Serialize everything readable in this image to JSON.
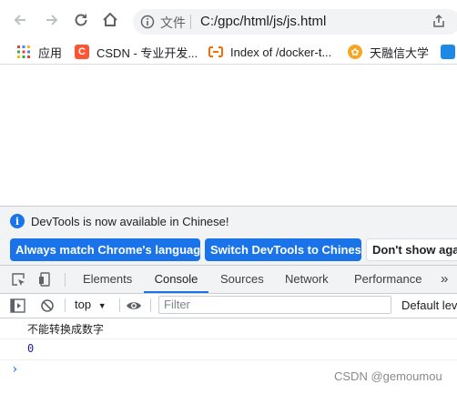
{
  "browser": {
    "address_prefix": "文件",
    "url": "C:/gpc/html/js/js.html"
  },
  "bookmarks": [
    {
      "label": "应用",
      "icon": "apps-grid-icon"
    },
    {
      "label": "CSDN - 专业开发...",
      "icon": "csdn-icon",
      "color": "#fc5531"
    },
    {
      "label": "Index of /docker-t...",
      "icon": "aliyun-icon",
      "color": "#ff6a00"
    },
    {
      "label": "天融信大学",
      "icon": "topsec-icon",
      "color": "#f5a623"
    }
  ],
  "devtools": {
    "info_message": "DevTools is now available in Chinese!",
    "always_match_button": "Always match Chrome's language",
    "switch_button": "Switch DevTools to Chinese",
    "dont_show_button": "Don't show agai",
    "tabs": [
      "Elements",
      "Console",
      "Sources",
      "Network",
      "Performance"
    ],
    "active_tab": "Console",
    "more_tabs": "»",
    "context": "top",
    "filter_placeholder": "Filter",
    "levels": "Default lev",
    "console_lines": [
      "不能转换成数字",
      "0"
    ],
    "prompt": "›"
  },
  "watermark": "CSDN @gemoumou",
  "colors": {
    "accent": "#1a73e8",
    "number": "#1a1aa6"
  }
}
